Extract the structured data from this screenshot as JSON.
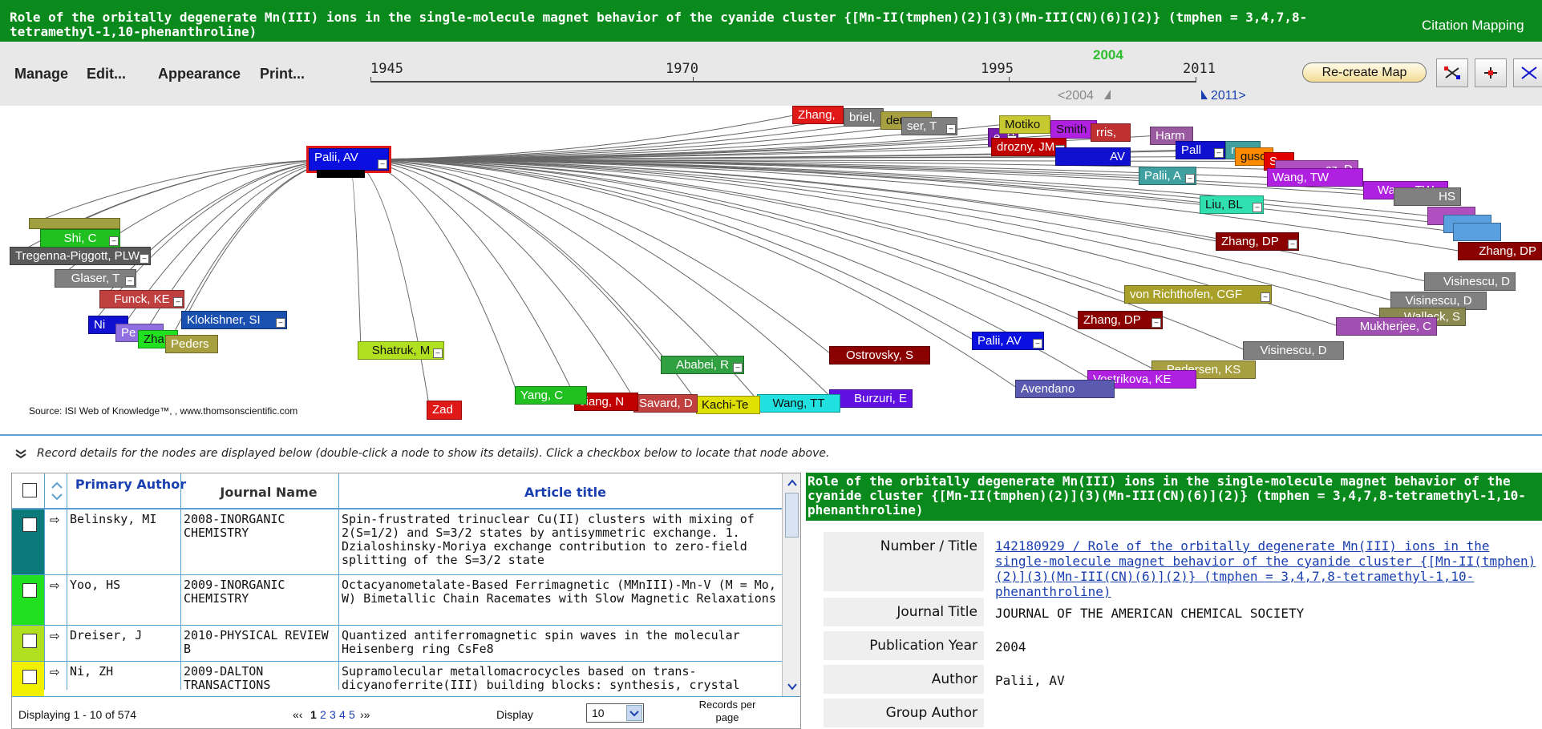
{
  "title_bar": {
    "title": "Role of the orbitally degenerate Mn(III) ions in the single-molecule magnet behavior of the cyanide cluster {[Mn-II(tmphen)(2)](3)(Mn-III(CN)(6)](2)} (tmphen = 3,4,7,8-tetramethyl-1,10-phenanthroline)",
    "app_label": "Citation Mapping"
  },
  "menu": {
    "manage": "Manage",
    "edit": "Edit...",
    "appearance": "Appearance",
    "print": "Print..."
  },
  "timeline": {
    "years": [
      "1945",
      "1970",
      "1995",
      "2011"
    ],
    "selected_year": "2004",
    "range_start": "<2004",
    "range_end": "2011>"
  },
  "toolbar": {
    "recreate_label": "Re-create Map"
  },
  "map": {
    "source_note": "Source: ISI Web of Knowledge™, , www.thomsonscientific.com",
    "nodes": [
      {
        "label": "Palii, AV",
        "color": "#0a10e0"
      },
      {
        "label": "Zhang,",
        "color": "#e01818"
      },
      {
        "label": "briel,",
        "color": "#7a7a7a"
      },
      {
        "label": "dersen",
        "color": "#a8a040"
      },
      {
        "label": "ser, T",
        "color": "#808080"
      },
      {
        "label": "e, P",
        "color": "#7a1bb0"
      },
      {
        "label": "Motiko",
        "color": "#c8c830"
      },
      {
        "label": "Smith",
        "color": "#b020e0"
      },
      {
        "label": "rris,",
        "color": "#c03030"
      },
      {
        "label": "drozny, JM",
        "color": "#c00000"
      },
      {
        "label": "AV",
        "color": "#1010d0"
      },
      {
        "label": "Harm",
        "color": "#9a5aa0"
      },
      {
        "label": "Pall",
        "color": "#1010d0"
      },
      {
        "label": "mos,",
        "color": "#40a0a0"
      },
      {
        "label": "guso",
        "color": "#ff8c00"
      },
      {
        "label": "S",
        "color": "#e00000"
      },
      {
        "label": "cz, D",
        "color": "#b050c0"
      },
      {
        "label": "Palii, A",
        "color": "#40a0a0"
      },
      {
        "label": "Wang, TW",
        "color": "#b020e0"
      },
      {
        "label": "Liu, BL",
        "color": "#30e0b0"
      },
      {
        "label": "HS",
        "color": "#808080"
      },
      {
        "label": "Zhang, DP",
        "color": "#8b0000"
      },
      {
        "label": "Zhang, DP",
        "color": "#8b0000"
      },
      {
        "label": "Visinescu, D",
        "color": "#808080"
      },
      {
        "label": "von Richthofen, CGF",
        "color": "#a8a028"
      },
      {
        "label": "Visinescu, D",
        "color": "#808080"
      },
      {
        "label": "Walleck, S",
        "color": "#8a8a50"
      },
      {
        "label": "Mukherjee, C",
        "color": "#a050b0"
      },
      {
        "label": "Zhang, DP",
        "color": "#8b0000"
      },
      {
        "label": "Visinescu, D",
        "color": "#808080"
      },
      {
        "label": "Palii, AV",
        "color": "#0a10e0"
      },
      {
        "label": "Pedersen, KS",
        "color": "#a8a040"
      },
      {
        "label": "Vostrikova, KE",
        "color": "#b020e0"
      },
      {
        "label": "Avendano",
        "color": "#5a5ab0"
      },
      {
        "label": "Ostrovsky, S",
        "color": "#8b0000"
      },
      {
        "label": "Burzuri, E",
        "color": "#6010e0"
      },
      {
        "label": "Wang, TT",
        "color": "#20e0e0"
      },
      {
        "label": "Kachi-Te",
        "color": "#e0e000"
      },
      {
        "label": "Savard, D",
        "color": "#c04040"
      },
      {
        "label": "Jiang, N",
        "color": "#c00000"
      },
      {
        "label": "Yang, C",
        "color": "#20c020"
      },
      {
        "label": "Ababei, R",
        "color": "#30a040"
      },
      {
        "label": "Zad",
        "color": "#e01818"
      },
      {
        "label": "Shatruk, M",
        "color": "#b0e020"
      },
      {
        "label": "Peders",
        "color": "#a8a040"
      },
      {
        "label": "Zha",
        "color": "#20e020"
      },
      {
        "label": "Pe",
        "color": "#9070e0"
      },
      {
        "label": "Ni",
        "color": "#1010d0"
      },
      {
        "label": "Klokishner, SI",
        "color": "#1a50b0"
      },
      {
        "label": "Funck, KE",
        "color": "#c04040"
      },
      {
        "label": "Glaser, T",
        "color": "#808080"
      },
      {
        "label": "Tregenna-Piggott, PLW",
        "color": "#5a5a5a"
      },
      {
        "label": "Shi, C",
        "color": "#20c020"
      }
    ]
  },
  "details_hint": "Record details for the nodes are displayed below (double-click a node to show its details). Click a checkbox below to locate that node above.",
  "table": {
    "headers": {
      "author": "Primary Author",
      "journal": "Journal Name",
      "title": "Article title"
    },
    "rows": [
      {
        "color": "#0a7a7a",
        "author": "Belinsky, MI",
        "journal": "2008-INORGANIC CHEMISTRY",
        "title": "Spin-frustrated trinuclear Cu(II) clusters with mixing of 2(S=1/2) and S=3/2 states by antisymmetric exchange. 1. Dzialoshinsky-Moriya exchange contribution to zero-field splitting of the S=3/2 state"
      },
      {
        "color": "#20e020",
        "author": "Yoo, HS",
        "journal": "2009-INORGANIC CHEMISTRY",
        "title": "Octacyanometalate-Based Ferrimagnetic (MMnIII)-Mn-V (M = Mo, W) Bimetallic Chain Racemates with Slow Magnetic Relaxations"
      },
      {
        "color": "#b0e020",
        "author": "Dreiser, J",
        "journal": "2010-PHYSICAL REVIEW B",
        "title": "Quantized antiferromagnetic spin waves in the molecular Heisenberg ring CsFe8"
      },
      {
        "color": "#f0f000",
        "author": "Ni, ZH",
        "journal": "2009-DALTON TRANSACTIONS",
        "title": "Supramolecular metallomacrocycles based on trans-dicyanoferrite(III) building blocks: synthesis, crystal"
      }
    ],
    "footer": {
      "displaying": "Displaying 1 - 10 of 574",
      "pager_prev": "«‹",
      "pages": [
        "1",
        "2",
        "3",
        "4",
        "5"
      ],
      "pager_next": "›»",
      "display_label": "Display",
      "per_page": "10",
      "records_label": "Records per page"
    }
  },
  "details": {
    "title": "Role of the orbitally degenerate Mn(III) ions in the single-molecule magnet behavior of the cyanide cluster {[Mn-II(tmphen)(2)](3)(Mn-III(CN)(6)](2)} (tmphen = 3,4,7,8-tetramethyl-1,10-phenanthroline)",
    "labels": {
      "number_title": "Number / Title",
      "journal_title": "Journal Title",
      "pub_year": "Publication Year",
      "author": "Author",
      "group_author": "Group Author"
    },
    "values": {
      "number_title": "142180929 / Role of the orbitally degenerate Mn(III) ions in the single-molecule magnet behavior of the cyanide cluster {[Mn-II(tmphen)(2)](3)(Mn-III(CN)(6)](2)} (tmphen = 3,4,7,8-tetramethyl-1,10-phenanthroline)",
      "journal_title": "JOURNAL OF THE AMERICAN CHEMICAL SOCIETY",
      "pub_year": "2004",
      "author": "Palii, AV",
      "group_author": ""
    }
  }
}
